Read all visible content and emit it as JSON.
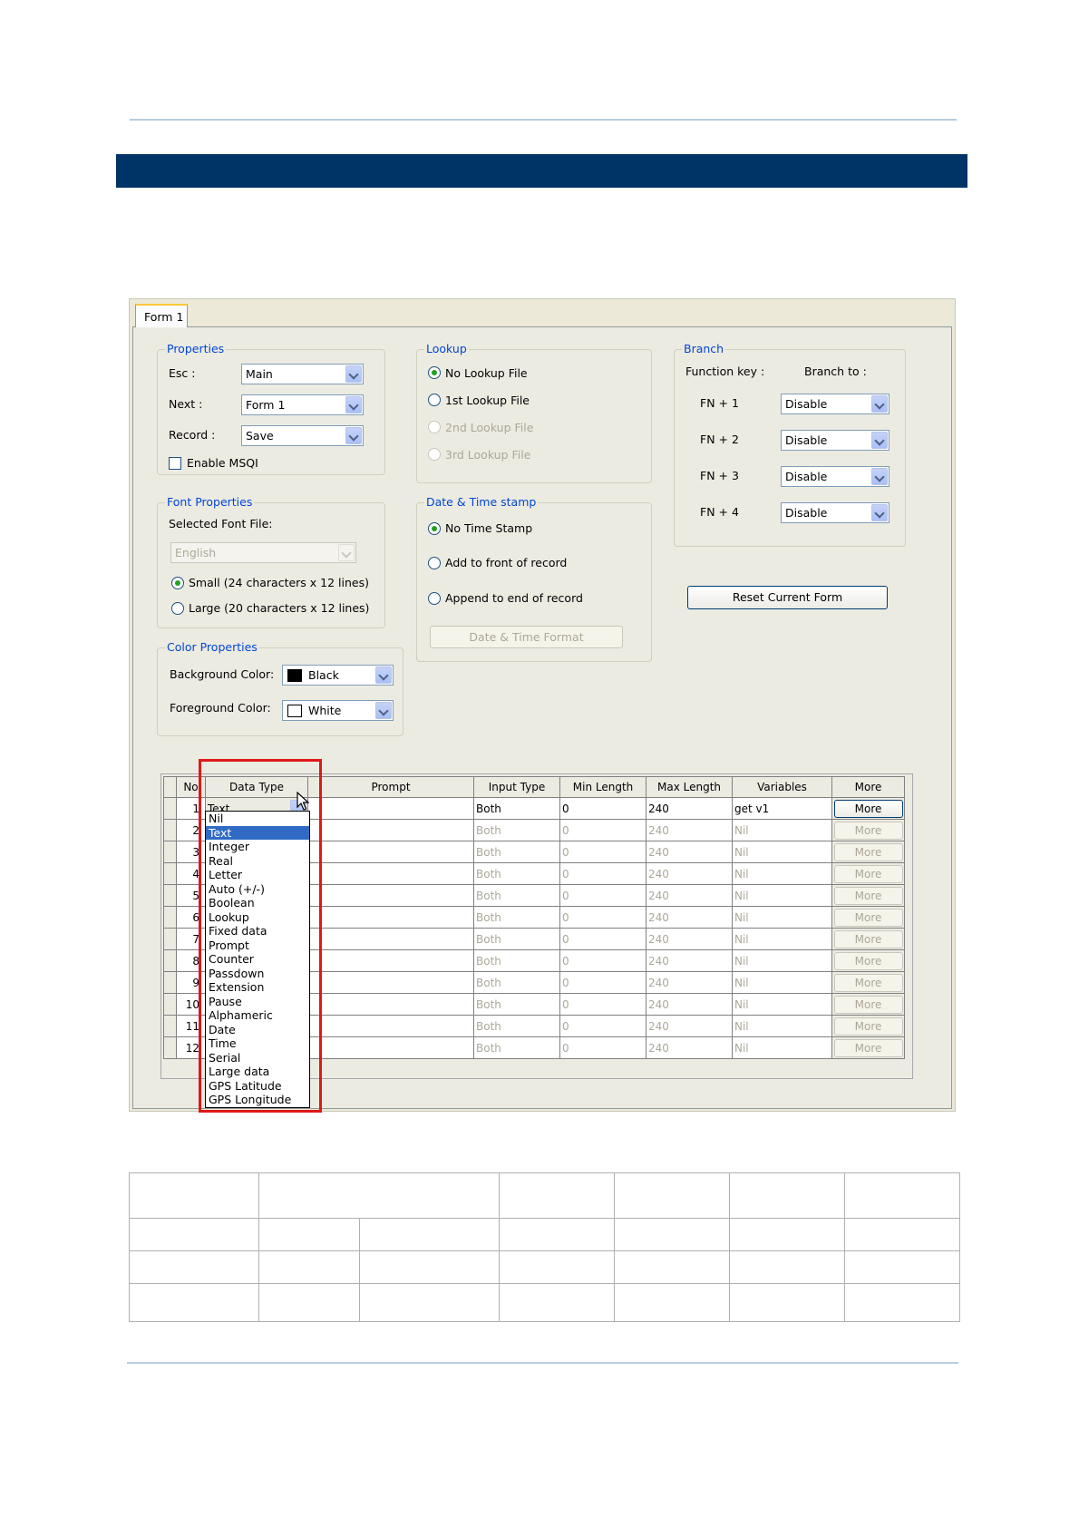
{
  "tab": {
    "label": "Form 1"
  },
  "properties": {
    "legend": "Properties",
    "esc_label": "Esc :",
    "esc_value": "Main",
    "next_label": "Next :",
    "next_value": "Form 1",
    "record_label": "Record :",
    "record_value": "Save",
    "msqi_label": "Enable MSQI",
    "msqi_checked": false
  },
  "lookup": {
    "legend": "Lookup",
    "options": [
      "No Lookup File",
      "1st Lookup File",
      "2nd Lookup File",
      "3rd Lookup File"
    ],
    "selected": "No Lookup File"
  },
  "branch": {
    "legend": "Branch",
    "function_key_label": "Function key :",
    "branch_to_label": "Branch to :",
    "rows": [
      {
        "key": "FN + 1",
        "value": "Disable"
      },
      {
        "key": "FN + 2",
        "value": "Disable"
      },
      {
        "key": "FN + 3",
        "value": "Disable"
      },
      {
        "key": "FN + 4",
        "value": "Disable"
      }
    ]
  },
  "font": {
    "legend": "Font Properties",
    "selected_font_label": "Selected Font File:",
    "font_value": "English",
    "small_label": "Small (24 characters x 12 lines)",
    "large_label": "Large (20 characters x 12 lines)",
    "selected": "small"
  },
  "datetime": {
    "legend": "Date & Time stamp",
    "options": [
      "No Time Stamp",
      "Add to front of record",
      "Append to end of record"
    ],
    "selected": "No Time Stamp",
    "format_button": "Date & Time Format"
  },
  "reset_button": "Reset Current Form",
  "color": {
    "legend": "Color Properties",
    "background_label": "Background Color:",
    "background_value": "Black",
    "background_hex": "#000000",
    "foreground_label": "Foreground Color:",
    "foreground_value": "White",
    "foreground_hex": "#ffffff"
  },
  "grid": {
    "headers": [
      "No",
      "Data Type",
      "Prompt",
      "Input Type",
      "Min Length",
      "Max Length",
      "Variables",
      "More"
    ],
    "rows": [
      {
        "no": "1",
        "type": "Text",
        "prompt": "",
        "input": "Both",
        "min": "0",
        "max": "240",
        "vars": "get v1",
        "more": "More"
      },
      {
        "no": "2",
        "type": "",
        "prompt": "",
        "input": "Both",
        "min": "0",
        "max": "240",
        "vars": "Nil",
        "more": "More"
      },
      {
        "no": "3",
        "type": "",
        "prompt": "",
        "input": "Both",
        "min": "0",
        "max": "240",
        "vars": "Nil",
        "more": "More"
      },
      {
        "no": "4",
        "type": "",
        "prompt": "",
        "input": "Both",
        "min": "0",
        "max": "240",
        "vars": "Nil",
        "more": "More"
      },
      {
        "no": "5",
        "type": "",
        "prompt": "",
        "input": "Both",
        "min": "0",
        "max": "240",
        "vars": "Nil",
        "more": "More"
      },
      {
        "no": "6",
        "type": "",
        "prompt": "",
        "input": "Both",
        "min": "0",
        "max": "240",
        "vars": "Nil",
        "more": "More"
      },
      {
        "no": "7",
        "type": "",
        "prompt": "",
        "input": "Both",
        "min": "0",
        "max": "240",
        "vars": "Nil",
        "more": "More"
      },
      {
        "no": "8",
        "type": "",
        "prompt": "",
        "input": "Both",
        "min": "0",
        "max": "240",
        "vars": "Nil",
        "more": "More"
      },
      {
        "no": "9",
        "type": "",
        "prompt": "",
        "input": "Both",
        "min": "0",
        "max": "240",
        "vars": "Nil",
        "more": "More"
      },
      {
        "no": "10",
        "type": "",
        "prompt": "",
        "input": "Both",
        "min": "0",
        "max": "240",
        "vars": "Nil",
        "more": "More"
      },
      {
        "no": "11",
        "type": "",
        "prompt": "",
        "input": "Both",
        "min": "0",
        "max": "240",
        "vars": "Nil",
        "more": "More"
      },
      {
        "no": "12",
        "type": "",
        "prompt": "",
        "input": "Both",
        "min": "0",
        "max": "240",
        "vars": "Nil",
        "more": "More"
      }
    ]
  },
  "data_type_options": [
    "Nil",
    "Text",
    "Integer",
    "Real",
    "Letter",
    "Auto (+/-)",
    "Boolean",
    "Lookup",
    "Fixed data",
    "Prompt",
    "Counter",
    "Passdown",
    "Extension",
    "Pause",
    "Alphameric",
    "Date",
    "Time",
    "Serial",
    "Large data",
    "GPS Latitude",
    "GPS Longitude"
  ],
  "data_type_selected": "Text",
  "colors": {
    "banner": "#003366",
    "highlight": "#e01818",
    "selection": "#316ac5"
  }
}
